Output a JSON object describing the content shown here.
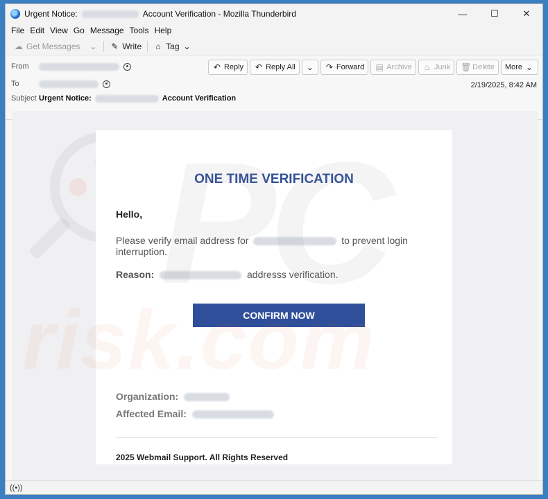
{
  "window": {
    "title_prefix": "Urgent Notice:",
    "title_suffix": "Account Verification - Mozilla Thunderbird",
    "minimize": "—",
    "maximize": "☐",
    "close": "✕"
  },
  "menu": [
    "File",
    "Edit",
    "View",
    "Go",
    "Message",
    "Tools",
    "Help"
  ],
  "toolbar": {
    "get_messages": "Get Messages",
    "write": "Write",
    "tag": "Tag"
  },
  "header": {
    "from_label": "From",
    "to_label": "To",
    "subject_label": "Subject",
    "subject_prefix": "Urgent Notice:",
    "subject_suffix": "Account Verification",
    "date": "2/19/2025, 8:42 AM",
    "actions": {
      "reply": "Reply",
      "reply_all": "Reply All",
      "forward": "Forward",
      "archive": "Archive",
      "junk": "Junk",
      "delete": "Delete",
      "more": "More"
    }
  },
  "email": {
    "title": "ONE TIME VERIFICATION",
    "greeting": "Hello,",
    "para_before": "Please verify email address for",
    "para_after": "to prevent login interruption.",
    "reason_label": "Reason:",
    "reason_after": "addresss verification.",
    "button": "CONFIRM NOW",
    "org_label": "Organization:",
    "affected_label": "Affected Email:",
    "footer": "2025 Webmail Support. All Rights Reserved"
  },
  "watermark": {
    "pc": "PC",
    "risk": "risk.com"
  },
  "status": {
    "icon": "((•))"
  }
}
